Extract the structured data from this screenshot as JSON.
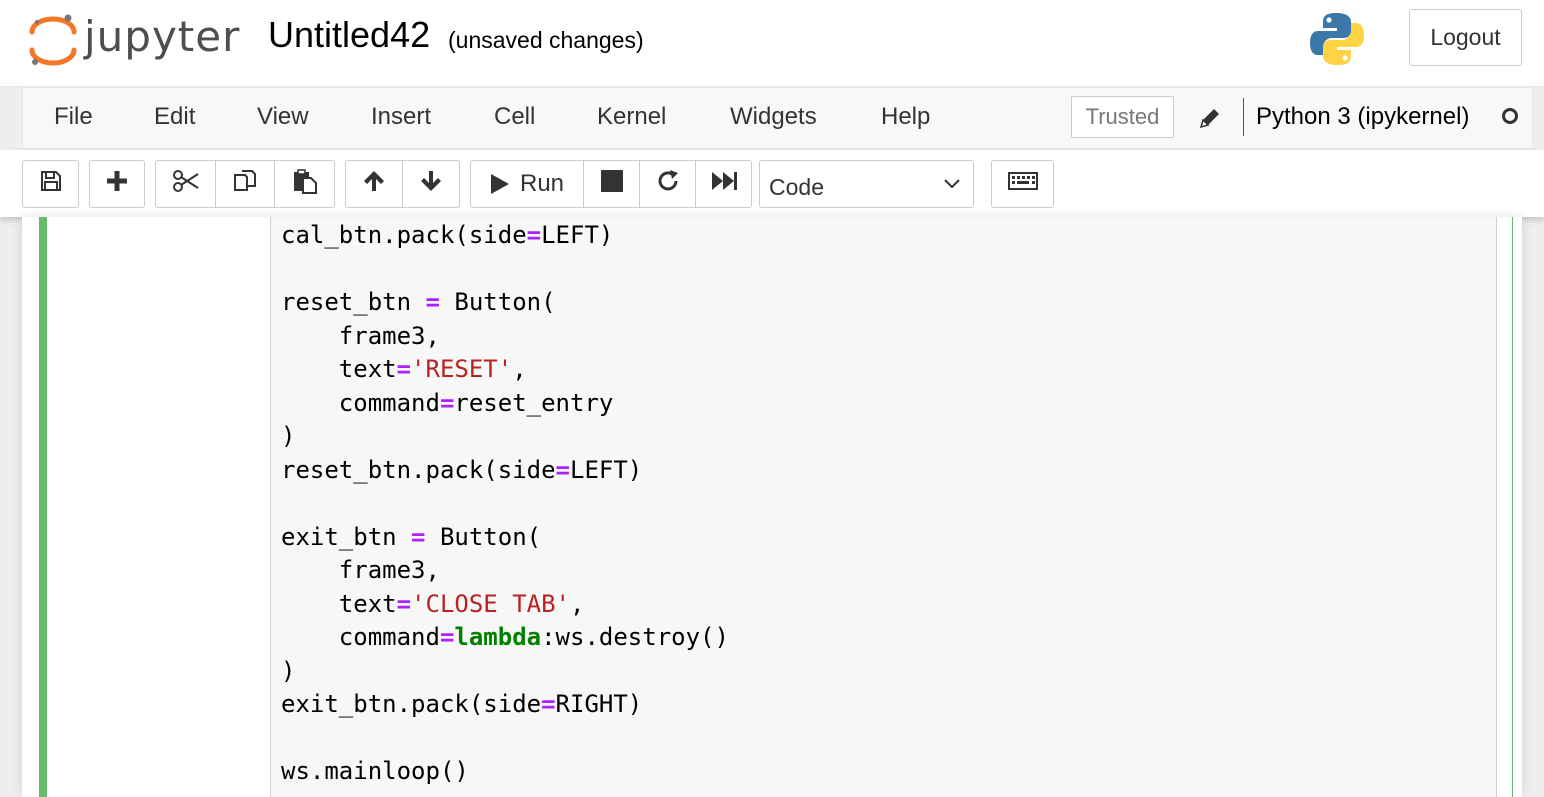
{
  "header": {
    "brand": "jupyter",
    "notebook_name": "Untitled42",
    "save_status": "(unsaved changes)",
    "logout_label": "Logout"
  },
  "menubar": {
    "items": [
      "File",
      "Edit",
      "View",
      "Insert",
      "Cell",
      "Kernel",
      "Widgets",
      "Help"
    ],
    "trusted_label": "Trusted",
    "kernel_name": "Python 3 (ipykernel)"
  },
  "toolbar": {
    "run_label": "Run",
    "cell_type": "Code",
    "icons": [
      "save-icon",
      "plus-icon",
      "scissors-icon",
      "copy-icon",
      "paste-icon",
      "arrow-up-icon",
      "arrow-down-icon",
      "play-icon",
      "stop-icon",
      "restart-icon",
      "fast-forward-icon",
      "chevron-down-icon",
      "keyboard-icon"
    ]
  },
  "colors": {
    "cell_selected_border": "#66bb6a",
    "code_operator": "#aa22ff",
    "code_string": "#ba2121",
    "code_keyword": "#008000"
  },
  "code": {
    "lines": [
      [
        {
          "t": "cal_btn.pack(side"
        },
        {
          "t": "=",
          "c": "op"
        },
        {
          "t": "LEFT)"
        }
      ],
      [],
      [
        {
          "t": "reset_btn "
        },
        {
          "t": "=",
          "c": "op"
        },
        {
          "t": " Button("
        }
      ],
      [
        {
          "t": "    frame3,"
        }
      ],
      [
        {
          "t": "    text"
        },
        {
          "t": "=",
          "c": "op"
        },
        {
          "t": "'RESET'",
          "c": "str"
        },
        {
          "t": ","
        }
      ],
      [
        {
          "t": "    command"
        },
        {
          "t": "=",
          "c": "op"
        },
        {
          "t": "reset_entry"
        }
      ],
      [
        {
          "t": ")"
        }
      ],
      [
        {
          "t": "reset_btn.pack(side"
        },
        {
          "t": "=",
          "c": "op"
        },
        {
          "t": "LEFT)"
        }
      ],
      [],
      [
        {
          "t": "exit_btn "
        },
        {
          "t": "=",
          "c": "op"
        },
        {
          "t": " Button("
        }
      ],
      [
        {
          "t": "    frame3,"
        }
      ],
      [
        {
          "t": "    text"
        },
        {
          "t": "=",
          "c": "op"
        },
        {
          "t": "'CLOSE TAB'",
          "c": "str"
        },
        {
          "t": ","
        }
      ],
      [
        {
          "t": "    command"
        },
        {
          "t": "=",
          "c": "op"
        },
        {
          "t": "lambda",
          "c": "kw"
        },
        {
          "t": ":ws.destroy()"
        }
      ],
      [
        {
          "t": ")"
        }
      ],
      [
        {
          "t": "exit_btn.pack(side"
        },
        {
          "t": "=",
          "c": "op"
        },
        {
          "t": "RIGHT)"
        }
      ],
      [],
      [
        {
          "t": "ws.mainloop()"
        }
      ]
    ]
  }
}
